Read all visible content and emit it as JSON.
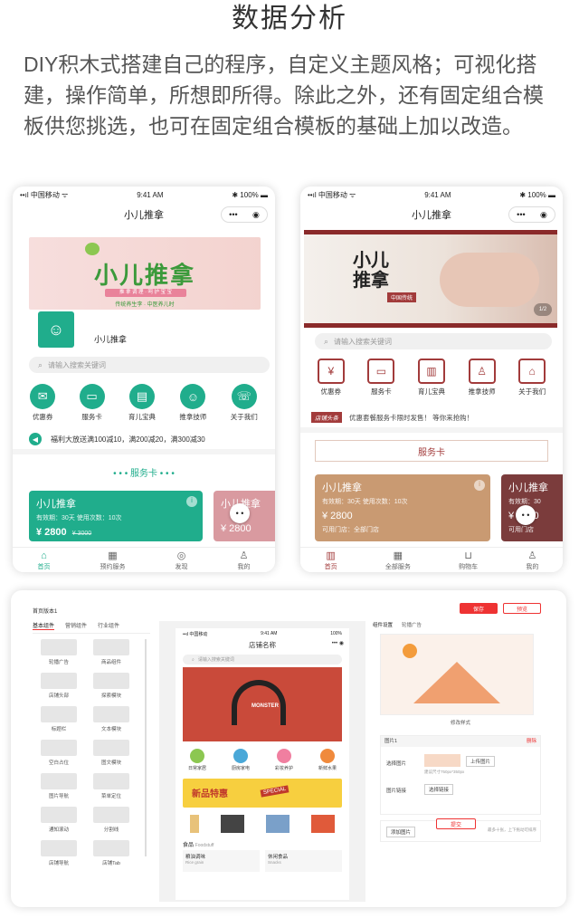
{
  "header": {
    "title": "数据分析",
    "description": "DIY积木式搭建自己的程序，自定义主题风格；可视化搭建，操作简单，所想即所得。除此之外，还有固定组合模板供您挑选，也可在固定组合模板的基础上加以改造。"
  },
  "phone1": {
    "status": {
      "carrier": "••ıl 中国移动 ᯤ",
      "time": "9:41 AM",
      "battery": "✱ 100% ▬"
    },
    "nav_title": "小儿推拿",
    "capsule": {
      "dots": "•••",
      "target": "◉"
    },
    "banner": {
      "logo_text": "小儿推拿",
      "tagline": "推 拿 调 理 · 呵 护 宝 宝",
      "subtitle": "传统养生李 · 中医养儿时"
    },
    "store_name": "小儿推拿",
    "search_placeholder": "请输入搜索关键词",
    "icons": [
      {
        "label": "优惠券",
        "glyph": "✉"
      },
      {
        "label": "服务卡",
        "glyph": "▭"
      },
      {
        "label": "育儿宝典",
        "glyph": "▤"
      },
      {
        "label": "推拿技师",
        "glyph": "☺"
      },
      {
        "label": "关于我们",
        "glyph": "☏"
      }
    ],
    "notice": "福利大放送满100减10，满200减20，满300减30",
    "section_title": "• • •  服务卡  • • •",
    "card": {
      "title": "小儿推拿",
      "sub": "有效期：30天  使用次数：10次",
      "price": "¥ 2800",
      "orig": "¥ 3000"
    },
    "card2_title": "小儿推拿",
    "card2_price": "¥ 2800",
    "tabs": [
      {
        "label": "首页",
        "glyph": "⌂"
      },
      {
        "label": "预约服务",
        "glyph": "▦"
      },
      {
        "label": "发现",
        "glyph": "◎"
      },
      {
        "label": "我的",
        "glyph": "♙"
      }
    ],
    "colors": {
      "accent": "#20ad8c"
    }
  },
  "phone2": {
    "status": {
      "carrier": "••ıl 中国移动 ᯤ",
      "time": "9:41 AM",
      "battery": "✱ 100% ▬"
    },
    "nav_title": "小儿推拿",
    "capsule": {
      "dots": "•••",
      "target": "◉"
    },
    "banner": {
      "calligraphy": "小儿推拿",
      "seal": "中国传统",
      "page": "1/2"
    },
    "search_placeholder": "请输入搜索关键词",
    "icons": [
      {
        "label": "优惠券",
        "glyph": "¥"
      },
      {
        "label": "服务卡",
        "glyph": "▭"
      },
      {
        "label": "育儿宝典",
        "glyph": "▥"
      },
      {
        "label": "推拿技师",
        "glyph": "♙"
      },
      {
        "label": "关于我们",
        "glyph": "⌂"
      }
    ],
    "headline_tag": "店铺头条",
    "headline": "优惠套餐服务卡限时发售！ 等你来抢购！",
    "section_title": "服务卡",
    "card": {
      "title": "小儿推拿",
      "sub": "有效期：30天  使用次数：10次",
      "price": "¥ 2800",
      "store": "可用门店：全部门店"
    },
    "card2_title": "小儿推拿",
    "card2_sub": "有效期：30",
    "card2_price": "¥ 2800",
    "card2_store": "可用门店",
    "tabs": [
      {
        "label": "首页",
        "glyph": "▥"
      },
      {
        "label": "全部服务",
        "glyph": "▦"
      },
      {
        "label": "购物车",
        "glyph": "⊔"
      },
      {
        "label": "我的",
        "glyph": "♙"
      }
    ],
    "colors": {
      "accent": "#a23b3b"
    }
  },
  "editor": {
    "page_label": "首页版本1",
    "publish_btn": "保存",
    "preview_btn": "预览",
    "left_tabs": [
      "基本组件",
      "营销组件",
      "行业组件"
    ],
    "components": [
      "轮播广告",
      "商品组件",
      "店铺头部",
      "探索模块",
      "标题栏",
      "文本模块",
      "空白占位",
      "图文模块",
      "图片导航",
      "菜单定位",
      "通知滚动",
      "分割线",
      "店铺导航",
      "店铺Tab"
    ],
    "preview": {
      "status": {
        "carrier": "••ıl 中国移动",
        "time": "9:41 AM",
        "battery": "100%"
      },
      "title": "店铺名称",
      "capsule": "••• ◉",
      "search": "请输入搜索关键词",
      "banner_brand": "MONSTER",
      "cats": [
        "日常家居",
        "厨房家电",
        "彩妆养护",
        "新鲜水果"
      ],
      "promo": "新品特惠",
      "promo_tag": "SPECIAL",
      "food_title": "食品",
      "food_sub": "Foodstuff",
      "food_items": [
        {
          "name": "粮油调味",
          "sub": "Rice grain"
        },
        {
          "name": "休闲食品",
          "sub": "Snacks"
        }
      ]
    },
    "right": {
      "tabs": [
        "组件设置",
        "轮播广告"
      ],
      "caption": "修改样式",
      "pic_label": "图片1",
      "delete": "删除",
      "select_label": "选择图片",
      "upload_btn": "上传图片",
      "hint": "建议尺寸750px*350px",
      "link_label": "图片链接",
      "link_btn": "选择链接",
      "add_btn": "添加图片",
      "add_hint": "最多十张，上下拖动可排序",
      "confirm": "提交"
    }
  }
}
